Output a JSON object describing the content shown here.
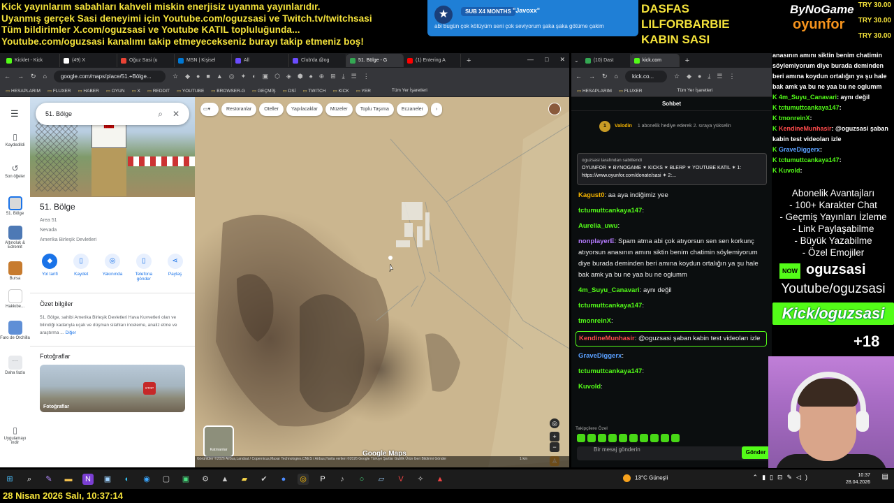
{
  "overlay": {
    "ticker_lines": [
      "Kick yayınlarım sabahları kahveli miskin enerjisiz uyanma yayınlarıdır.",
      "Uyanmış gerçek Sasi deneyimi için Youtube.com/oguzsasi ve Twitch.tv/twitchsasi",
      "Tüm bildirimler X.com/oguzsasi ve Youtube KATIL topluluğunda...",
      "Youtube.com/oguzsasi kanalımı takip etmeyecekseniz burayı takip etmeniz boş!"
    ],
    "sub_alert": {
      "tag": "SUB X4 MONTHS",
      "user": "\"Javoxx\"",
      "message": "abi bugün çok kötüyüm seni çok seviyorum şaka şaka götüme çakim"
    },
    "names": [
      "DASFAS",
      "LILFORBARBIE",
      "KABIN SASI"
    ],
    "brand": {
      "top": "ByNoGame",
      "domain": ".com",
      "bottom": "oyunfor",
      "prices": [
        "TRY 30.00",
        "TRY 30.00",
        "TRY 30.00"
      ]
    },
    "right_chat": [
      {
        "user": "",
        "text": "anasının amını siktin benim chatimin söylemiyorum diye burada deminden beri amına koydun ortalığın ya şu hale bak amk ya bu ne yaa bu ne oglumm"
      },
      {
        "user": "4m_Suyu_Canavari",
        "text": ": aynı değil"
      },
      {
        "user": "tctumuttcankaya147",
        "text": ":"
      },
      {
        "user": "tmonreinX",
        "text": ":"
      },
      {
        "user": "KendineMunhasir",
        "text": ": @oguzsasi şaban kabin test videoları izle"
      },
      {
        "user": "GraveDiggerx",
        "text": ":"
      },
      {
        "user": "tctumuttcankaya147",
        "text": ":"
      },
      {
        "user": "Kuvold",
        "text": ":"
      }
    ],
    "perks": [
      "Abonelik Avantajları",
      "- 100+ Karakter Chat",
      "- Geçmiş Yayınları İzleme",
      "- Link Paylaşabilme",
      "- Büyük Yazabilme",
      "- Özel Emojiler"
    ],
    "social": {
      "now": "NOW",
      "handle": "oguzsasi",
      "youtube": "Youtube/oguzsasi",
      "kick": "Kick/oguzsasi"
    },
    "age": "+18",
    "clock": "28 Nisan 2026 Salı, 10:37:14"
  },
  "left_browser": {
    "tabs": [
      "Kicklet - Kick",
      "(49) X",
      "Oğuz Sasi (u",
      "MSN | Kişisel",
      "All",
      "Club'da @og",
      "51. Bölge - G",
      "(1) Entering A"
    ],
    "tab_colors": [
      "#53fc18",
      "#ffffff",
      "#ea4335",
      "#0078d4",
      "#6b4cff",
      "#6b4cff",
      "#34a853",
      "#ff0000"
    ],
    "url": "google.com/maps/place/51.+Bölge...",
    "window_controls": [
      "—",
      "□",
      "✕"
    ],
    "bookmarks": [
      "HESAPLARIM",
      "FLUXER",
      "HABER",
      "OYUN",
      "X",
      "REDDIT",
      "YOUTUBE",
      "BROWSER-G",
      "GEÇMİŞ",
      "DSİ",
      "TWITCH",
      "KICK",
      "YER"
    ],
    "all_bookmarks": "Tüm Yer İşaretleri"
  },
  "maps": {
    "search_value": "51. Bölge",
    "rail": [
      {
        "icon": "▯",
        "label": "Kaydedildi"
      },
      {
        "icon": "↺",
        "label": "Son öğeler"
      },
      {
        "icon": "",
        "label": "51. Bölge"
      },
      {
        "icon": "",
        "label": "Altınoluk & Edremit"
      },
      {
        "icon": "",
        "label": "Bursa"
      },
      {
        "icon": "",
        "label": "Hakkıbe..."
      },
      {
        "icon": "",
        "label": "Faro de Orchilla"
      },
      {
        "icon": "···",
        "label": "Daha fazla"
      },
      {
        "icon": "▯",
        "label": "Uygulamayı indir"
      }
    ],
    "place": {
      "name": "51. Bölge",
      "alt_name": "Area 51",
      "state": "Nevada",
      "country": "Amerika Birleşik Devletleri"
    },
    "actions": [
      "Yol tarifi",
      "Kaydet",
      "Yakınında",
      "Telefona gönder",
      "Paylaş"
    ],
    "summary_title": "Özet bilgiler",
    "summary_text": "51. Bölge, sahibi Amerika Birleşik Devletleri Hava Kuvvetleri olan ve bilindiği kadarıyla uçak ve düşman silahları inceleme, analiz etme ve araştırma ...",
    "summary_more": "Diğer",
    "photos_title": "Fotoğraflar",
    "photo_label": "Fotoğraflar",
    "chips": [
      "Restoranlar",
      "Oteller",
      "Yapılacaklar",
      "Müzeler",
      "Toplu Taşıma",
      "Eczaneler"
    ],
    "layers_label": "Katmanlar",
    "google_logo": "Google Maps",
    "attribution": "Görüntüler ©2026 Airbus,Landsat / Copernicus,Maxar Technologies,CNES / Airbus,Harita verileri ©2026 Google   Türkiye   Şartlar   Gizlilik   Ürün Geri Bildirimi Gönder",
    "scale": "1 km"
  },
  "right_browser": {
    "tabs": [
      "(10) Dast",
      "kick.com"
    ],
    "bookmarks": [
      "HESAPLARIM",
      "FLUXER"
    ],
    "all_bookmarks": "Tüm Yer İşaretleri"
  },
  "kick_chat": {
    "header": "Sohbet",
    "goal_user": "Valodin",
    "goal_num": "1",
    "goal_text": "1 abonelik hediye ederek 2. sıraya yükselin",
    "pinned_by": "oguzsasi tarafından sabitlendi",
    "pinned_text": "OYUNFOR ✶ BYNOGAME ✶ KICKS ✶ BLERP ✶ YOUTUBE KATIL ✶ 1:",
    "pinned_link": "https://www.oyunfor.com/donate/sasi",
    "pinned_more": "✶ 2:...",
    "messages": [
      {
        "user": "Kagust0",
        "color": "#f5b400",
        "text": ": aa aya indiğimiz yee"
      },
      {
        "user": "tctumuttcankaya147",
        "color": "#53fc18",
        "text": ":"
      },
      {
        "user": "Aurelia_uwu",
        "color": "#53fc18",
        "text": ":"
      },
      {
        "user": "nonplayerE",
        "color": "#b57bff",
        "text": ": Spam atma abi çok atıyorsun sen sen korkunç atıyorsun anasının amını siktin benim chatimin söylemiyorum diye burada deminden beri amına koydun ortalığın ya şu hale bak amk ya bu ne yaa bu ne oglumm"
      },
      {
        "user": "4m_Suyu_Canavari",
        "color": "#53fc18",
        "text": ": aynı değil"
      },
      {
        "user": "tctumuttcankaya147",
        "color": "#53fc18",
        "text": ":"
      },
      {
        "user": "tmonreinX",
        "color": "#53fc18",
        "text": ":"
      },
      {
        "user": "KendineMunhasir",
        "color": "#ff4b4b",
        "text": ": @oguzsasi şaban kabin test videoları izle"
      },
      {
        "user": "GraveDiggerx",
        "color": "#5aa0ff",
        "text": ":"
      },
      {
        "user": "tctumuttcankaya147",
        "color": "#53fc18",
        "text": ":"
      },
      {
        "user": "Kuvold",
        "color": "#53fc18",
        "text": ":"
      }
    ],
    "followers_only": "Takipçilere Özel",
    "input_placeholder": "Bir mesaj gönderin",
    "send": "Gönder"
  },
  "taskbar": {
    "weather": "13°C  Güneşli",
    "time": "10:37",
    "date": "28.04.2026"
  }
}
